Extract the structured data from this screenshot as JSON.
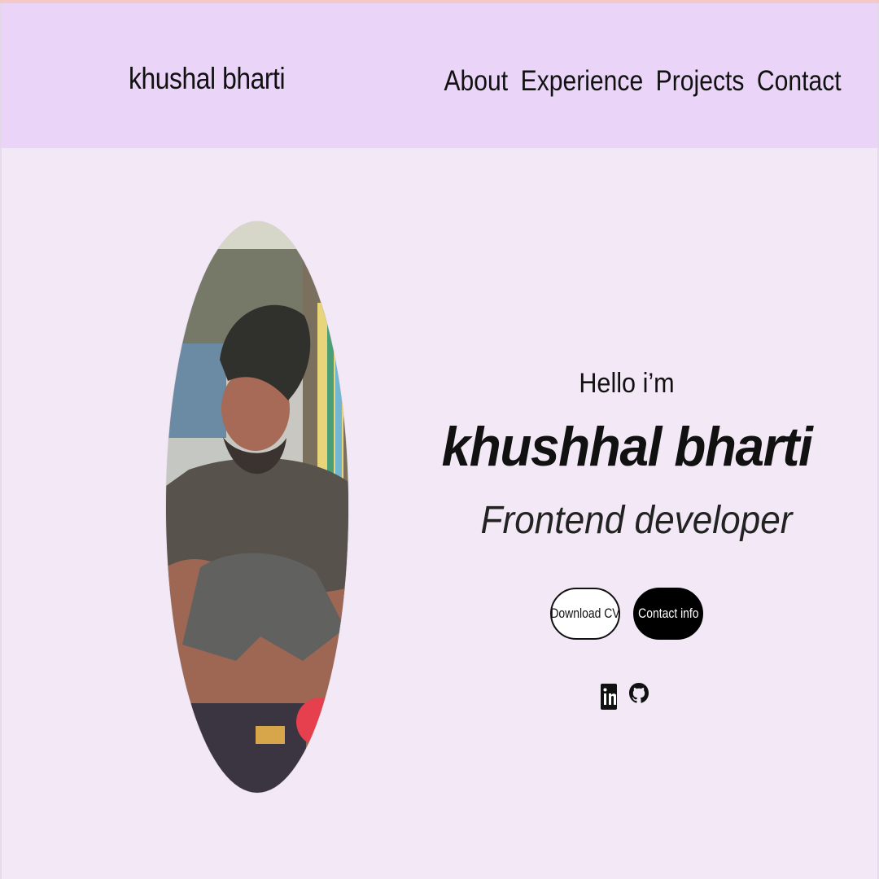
{
  "nav": {
    "logo": "khushal bharti",
    "links": [
      "About",
      "Experience",
      "Projects",
      "Contact"
    ]
  },
  "hero": {
    "greeting": "Hello i’m",
    "name": "khushhal bharti",
    "role": "Frontend developer",
    "buttons": {
      "download": "Download CV",
      "contact": "Contact info"
    },
    "profile_photo": "profile-photo",
    "social_icons": [
      "linkedin-icon",
      "github-icon"
    ]
  },
  "colors": {
    "nav_background": "#ead5f8",
    "page_background": "#f3e8f6",
    "button_dark": "#000000",
    "button_light": "#ffffff",
    "text": "#111111"
  }
}
